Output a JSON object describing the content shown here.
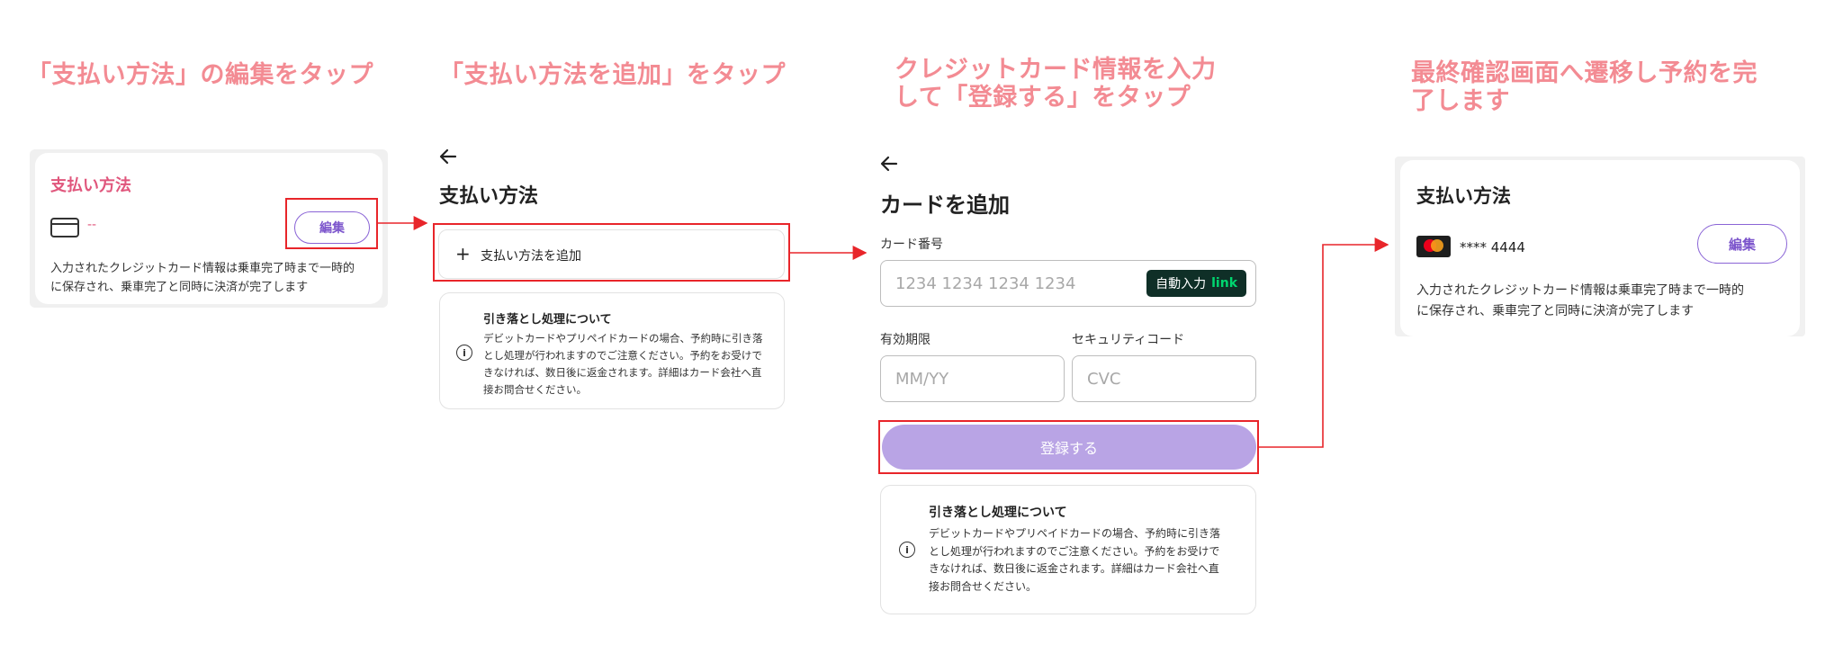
{
  "steps": [
    {
      "title_lines": [
        "「支払い方法」の編集をタップ"
      ]
    },
    {
      "title_lines": [
        "「支払い方法を追加」をタップ"
      ]
    },
    {
      "title_lines": [
        "クレジットカード情報を入力",
        "して「登録する」をタップ"
      ]
    },
    {
      "title_lines": [
        "最終確認画面へ遷移し予約を完",
        "了します"
      ]
    }
  ],
  "panel1": {
    "heading": "支払い方法",
    "card_placeholder": "--",
    "edit_label": "編集",
    "note_lines": [
      "入力されたクレジットカード情報は乗車完了時まで一時的",
      "に保存され、乗車完了と同時に決済が完了します"
    ],
    "icon": "credit-card-icon"
  },
  "panel2": {
    "back_icon": "arrow-left-icon",
    "heading": "支払い方法",
    "add_label": "支払い方法を追加",
    "info_title": "引き落とし処理について",
    "info_lines": [
      "デビットカードやプリペイドカードの場合、予約時に引き落",
      "とし処理が行われますのでご注意ください。予約をお受けで",
      "きなければ、数日後に返金されます。詳細はカード会社へ直",
      "接お問合せください。"
    ]
  },
  "panel3": {
    "back_icon": "arrow-left-icon",
    "heading": "カードを追加",
    "card_number_label": "カード番号",
    "card_number_placeholder": "1234 1234 1234 1234",
    "autofill_label": "自動入力",
    "autofill_brand": "link",
    "expiry_label": "有効期限",
    "expiry_placeholder": "MM/YY",
    "cvc_label": "セキュリティコード",
    "cvc_placeholder": "CVC",
    "submit_label": "登録する",
    "info_title": "引き落とし処理について",
    "info_lines": [
      "デビットカードやプリペイドカードの場合、予約時に引き落",
      "とし処理が行われますのでご注意ください。予約をお受けで",
      "きなければ、数日後に返金されます。詳細はカード会社へ直",
      "接お問合せください。"
    ]
  },
  "panel4": {
    "heading": "支払い方法",
    "card_mask": "**** 4444",
    "edit_label": "編集",
    "note_lines": [
      "入力されたクレジットカード情報は乗車完了時まで一時的",
      "に保存され、乗車完了と同時に決済が完了します"
    ],
    "card_brand_icon": "mastercard-icon"
  },
  "colors": {
    "step_title": "#f38b93",
    "accent_purple": "#7c55cc",
    "submit_disabled": "#b9a4e5",
    "highlight_red": "#e8252a",
    "link_green": "#00d66f"
  }
}
